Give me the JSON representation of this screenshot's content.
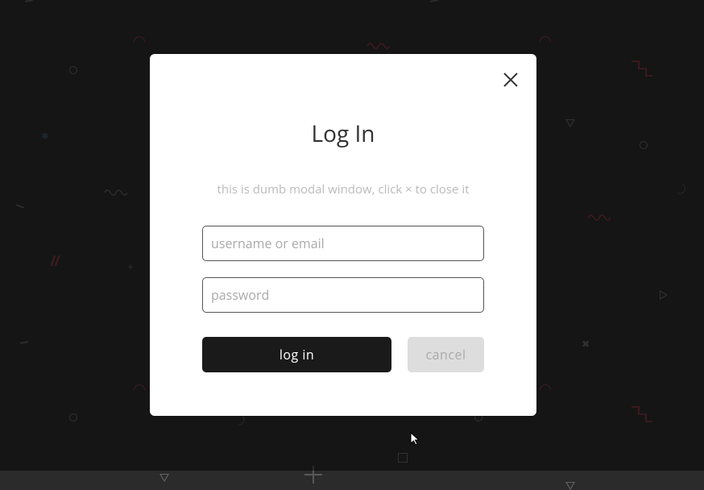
{
  "modal": {
    "title": "Log In",
    "subtitle": "this is dumb modal window, click × to close it",
    "username_placeholder": "username or email",
    "password_placeholder": "password",
    "login_label": "log in",
    "cancel_label": "cancel"
  }
}
